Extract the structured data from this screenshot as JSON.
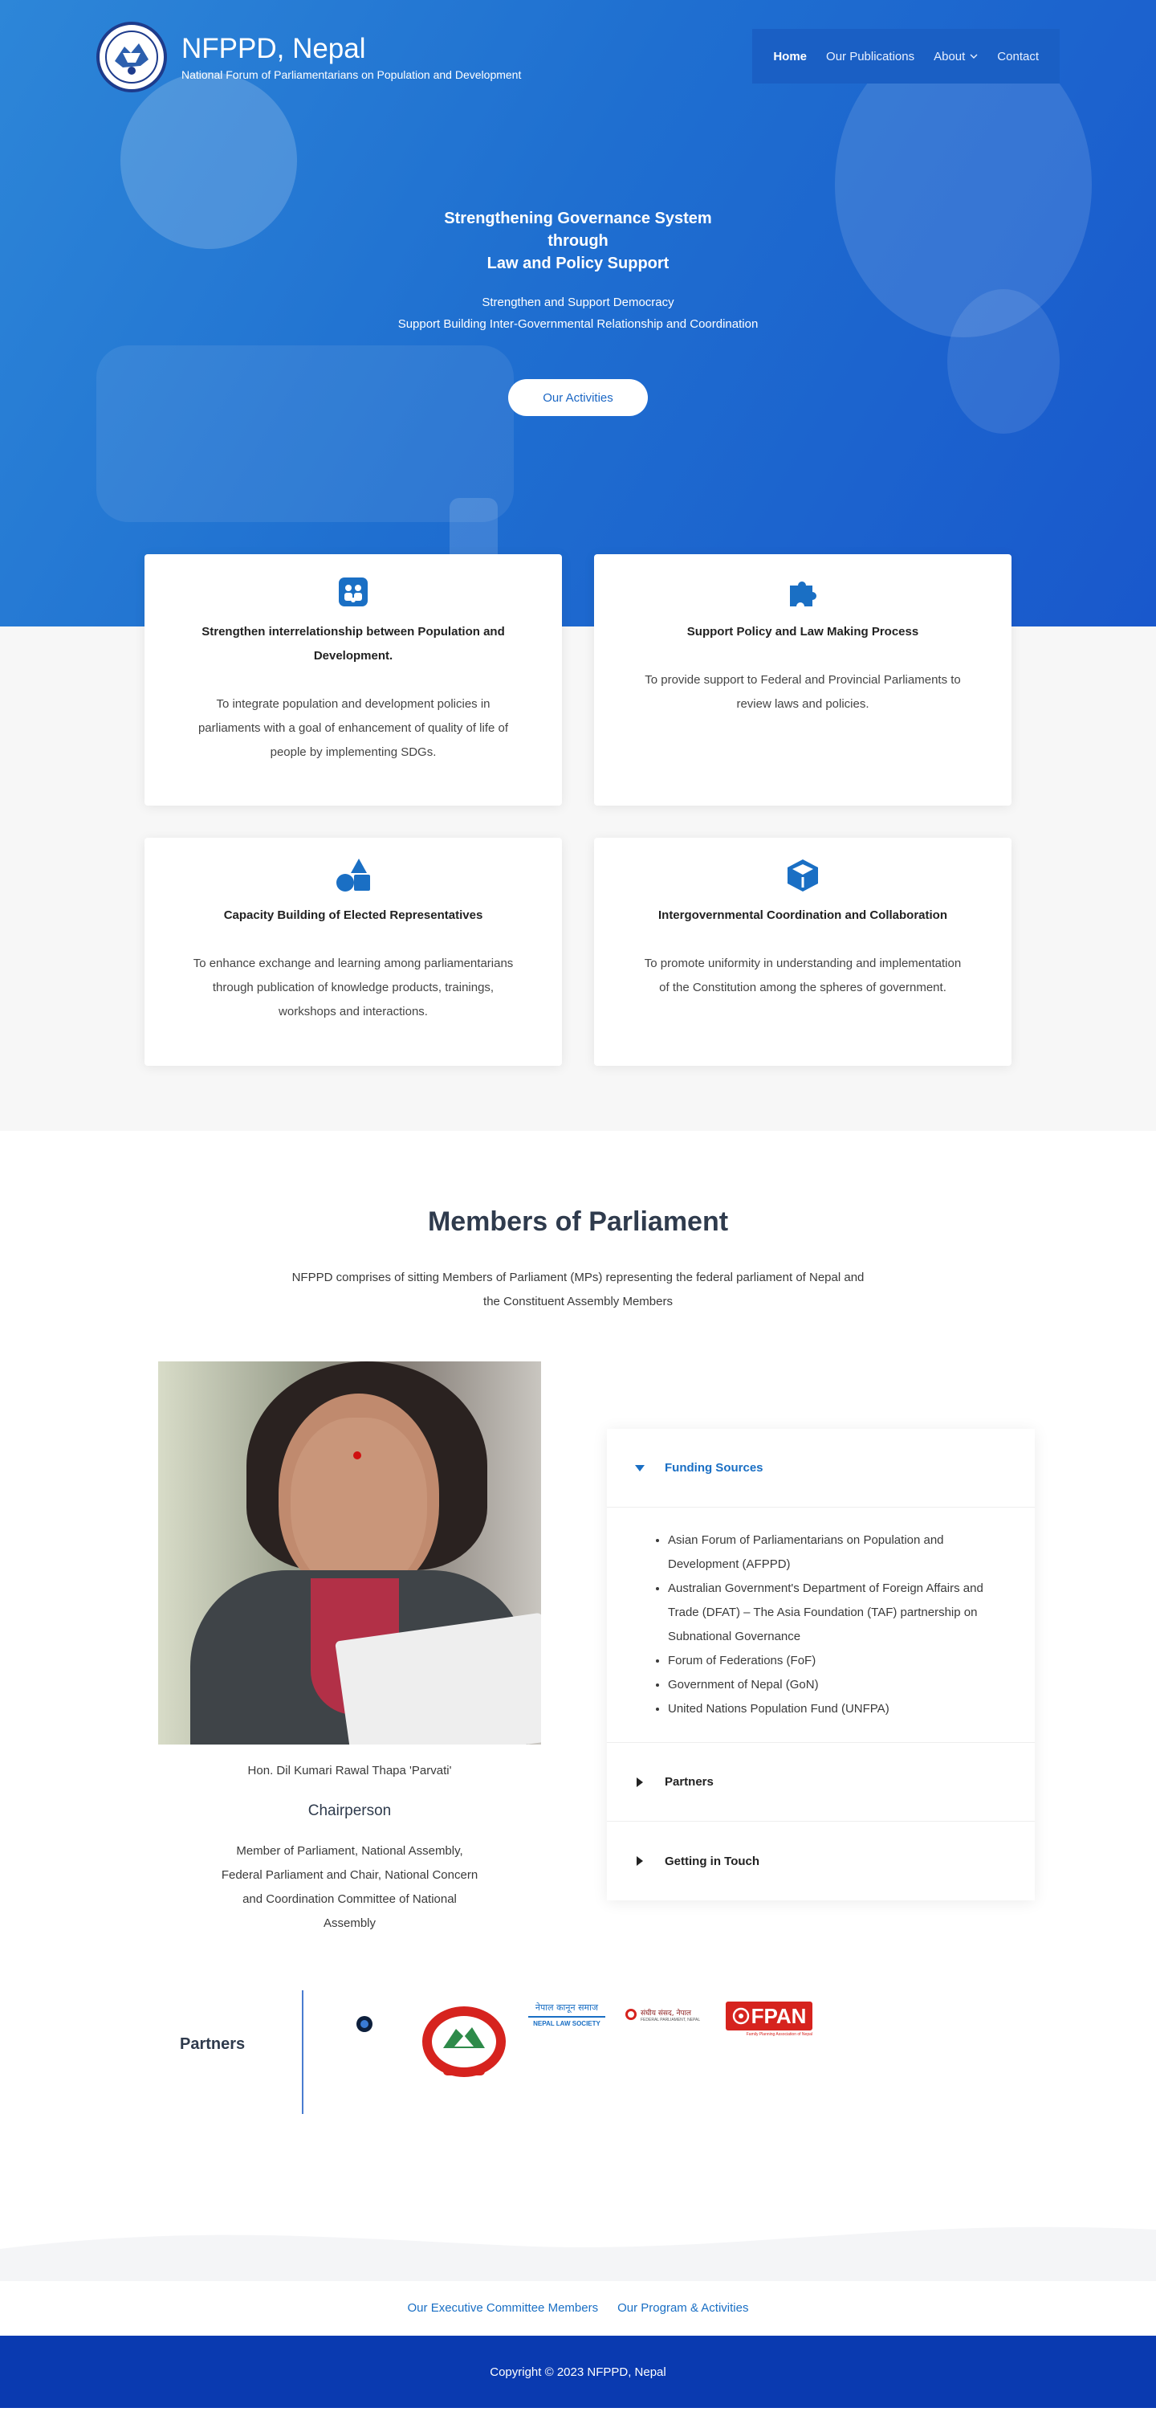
{
  "header": {
    "site_title": "NFPPD, Nepal",
    "site_tagline": "National Forum of Parliamentarians on Population and Development",
    "nav": [
      {
        "label": "Home"
      },
      {
        "label": "Our Publications"
      },
      {
        "label": "About"
      },
      {
        "label": "Contact"
      }
    ]
  },
  "hero": {
    "heading_line1": "Strengthening Governance System",
    "heading_line2": "through",
    "heading_line3": "Law and Policy Support",
    "line1": "Strengthen and Support Democracy",
    "line2": "Support Building Inter-Governmental Relationship and Coordination",
    "button_label": "Our Activities"
  },
  "cards": [
    {
      "icon": "users-icon",
      "title": "Strengthen interrelationship between Population and Development.",
      "text": "To integrate population and development policies in parliaments with a goal of enhancement of quality of life of people by implementing SDGs."
    },
    {
      "icon": "puzzle-icon",
      "title": "Support Policy and Law Making Process",
      "text": "To provide support to Federal and Provincial Parliaments to review laws and policies."
    },
    {
      "icon": "shapes-icon",
      "title": "Capacity Building of Elected Representatives",
      "text": "To enhance exchange and learning among parliamentarians through publication of knowledge products, trainings, workshops and interactions."
    },
    {
      "icon": "cube-icon",
      "title": "Intergovernmental Coordination and Collaboration",
      "text": "To promote uniformity in understanding and implementation of the Constitution among the spheres of government."
    }
  ],
  "members": {
    "title": "Members of Parliament",
    "intro": "NFPPD comprises of sitting Members of Parliament (MPs) representing the federal parliament of Nepal and the Constituent Assembly Members",
    "person_name": "Hon. Dil Kumari Rawal Thapa 'Parvati'",
    "person_role": "Chairperson",
    "person_desc": "Member of Parliament, National Assembly, Federal Parliament and Chair, National Concern and Coordination Committee of National Assembly"
  },
  "accordion": {
    "funding_title": "Funding Sources",
    "funding_items": [
      "Asian Forum of Parliamentarians on Population and Development (AFPPD)",
      "Australian Government's Department of Foreign Affairs and Trade (DFAT) – The Asia Foundation (TAF) partnership on Subnational Governance",
      "Forum of Federations (FoF)",
      "Government of Nepal (GoN)",
      "United Nations Population Fund (UNFPA)"
    ],
    "partners_title": "Partners",
    "contact_title": "Getting in Touch"
  },
  "partners": {
    "label": "Partners",
    "logos": {
      "law_society_np": "नेपाल कानून समाज",
      "law_society_en": "NEPAL LAW SOCIETY",
      "federal_np": "संघीय संसद, नेपाल",
      "federal_en": "FEDERAL PARLIAMENT, NEPAL",
      "fpan_text": "FPAN",
      "fpan_sub": "Family Planning Association of Nepal"
    }
  },
  "footer": {
    "links": [
      {
        "label": "Our Executive Committee Members"
      },
      {
        "label": "Our Program & Activities"
      }
    ],
    "copyright": "Copyright © 2023 NFPPD, Nepal"
  },
  "colors": {
    "primary": "#1a6fc4",
    "hero_blue": "#1f6fd0",
    "footer_blue": "#0a3ab0",
    "heading": "#2f3b4d"
  }
}
